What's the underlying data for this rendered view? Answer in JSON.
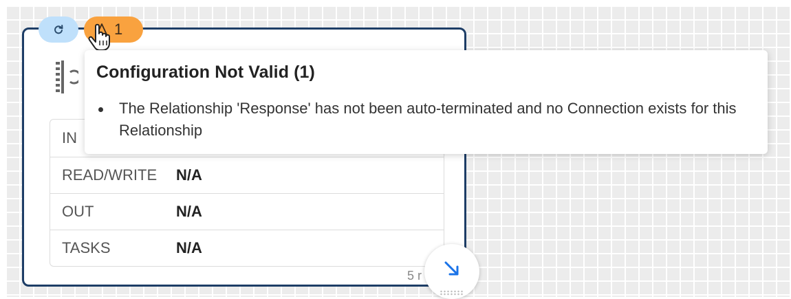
{
  "badges": {
    "refresh_icon": "refresh-icon",
    "warning_icon": "warning-icon",
    "warning_count": "1"
  },
  "tooltip": {
    "title": "Configuration Not Valid (1)",
    "items": [
      "The Relationship 'Response' has not been auto-terminated and no Connection exists for this Relationship"
    ]
  },
  "processor": {
    "stats": [
      {
        "label": "IN",
        "value": ""
      },
      {
        "label": "READ/WRITE",
        "value": "N/A"
      },
      {
        "label": "OUT",
        "value": "N/A"
      },
      {
        "label": "TASKS",
        "value": "N/A"
      }
    ],
    "footer": "5 r"
  },
  "colors": {
    "border": "#1d3d66",
    "refresh_badge": "#bfe0fb",
    "warning_badge": "#f9a23f",
    "expand_arrow": "#1a73e8"
  }
}
